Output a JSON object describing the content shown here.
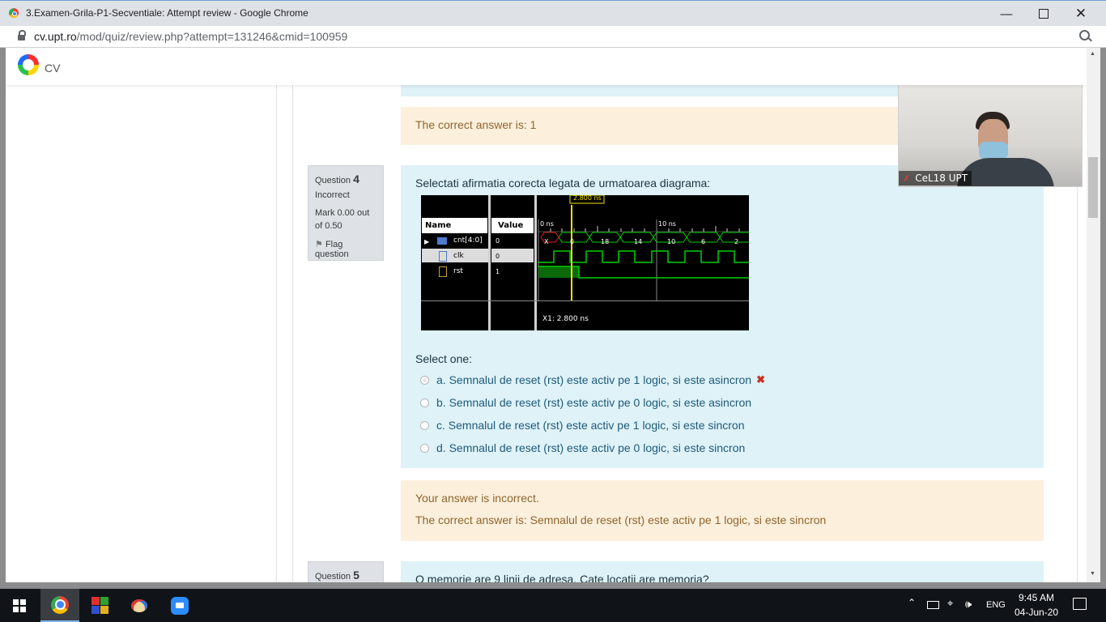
{
  "window": {
    "title": "3.Examen-Grila-P1-Secventiale: Attempt review - Google Chrome",
    "url_host": "cv.upt.ro",
    "url_path": "/mod/quiz/review.php?attempt=131246&cmid=100959"
  },
  "site": {
    "logo_text": "CV"
  },
  "prev_feedback": {
    "correct": "The correct answer is: 1"
  },
  "question4": {
    "label": "Question",
    "number": "4",
    "status": "Incorrect",
    "mark": "Mark 0.00 out of 0.50",
    "flag": "Flag question",
    "text": "Selectati afirmatia corecta legata de urmatoarea diagrama:",
    "select_one": "Select one:",
    "options": [
      "a. Semnalul de reset (rst) este activ pe 1 logic, si este asincron",
      "b. Semnalul de reset (rst) este activ pe 0 logic, si este asincron",
      "c. Semnalul de reset (rst) este activ pe 1 logic, si este sincron",
      "d. Semnalul de reset (rst) este activ pe 0 logic, si este sincron"
    ],
    "feedback_incorrect": "Your answer is incorrect.",
    "feedback_correct": "The correct answer is: Semnalul de reset (rst) este activ pe 1 logic, si este sincron"
  },
  "waveform": {
    "cursor_label": "2.800 ns",
    "col_name": "Name",
    "col_value": "Value",
    "t0": "0 ns",
    "t10": "10 ns",
    "signals": [
      {
        "name": "cnt[4:0]",
        "value": "0"
      },
      {
        "name": "clk",
        "value": "0"
      },
      {
        "name": "rst",
        "value": "1"
      }
    ],
    "bus_values": [
      "X",
      "0",
      "18",
      "14",
      "10",
      "6",
      "2"
    ],
    "cursor_readout": "X1: 2.800 ns"
  },
  "question5": {
    "label": "Question",
    "number": "5",
    "text": "O memorie are 9 linii de adresa. Cate locatii are memoria?"
  },
  "video": {
    "name": "CeL18 UPT"
  },
  "taskbar": {
    "lang": "ENG",
    "time": "9:45 AM",
    "date": "04-Jun-20"
  },
  "colors": {
    "accent": "#0f6cbf",
    "incorrect": "#ca3120",
    "question_bg": "#def2f8",
    "feedback_bg": "#fcefdc"
  }
}
